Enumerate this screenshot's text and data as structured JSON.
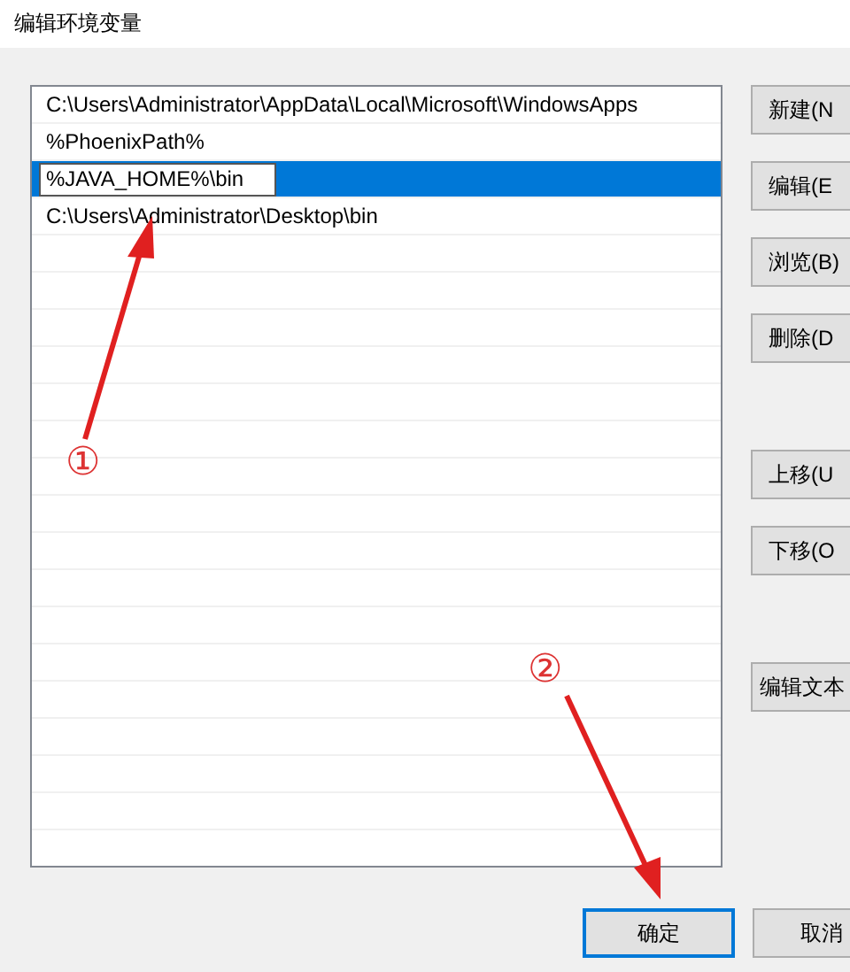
{
  "window": {
    "title": "编辑环境变量"
  },
  "entries": [
    {
      "text": "C:\\Users\\Administrator\\AppData\\Local\\Microsoft\\WindowsApps",
      "selected": false
    },
    {
      "text": "%PhoenixPath%",
      "selected": false
    },
    {
      "text": "%JAVA_HOME%\\bin",
      "selected": true
    },
    {
      "text": "C:\\Users\\Administrator\\Desktop\\bin",
      "selected": false
    }
  ],
  "side_button_groups": [
    [
      "新建(N",
      "编辑(E",
      "浏览(B)",
      "删除(D"
    ],
    [
      "上移(U",
      "下移(O"
    ],
    [
      "编辑文本"
    ]
  ],
  "annotations": [
    "①",
    "②"
  ],
  "footer_buttons": [
    {
      "label": "确定",
      "default": true
    },
    {
      "label": "取消",
      "default": false
    }
  ]
}
